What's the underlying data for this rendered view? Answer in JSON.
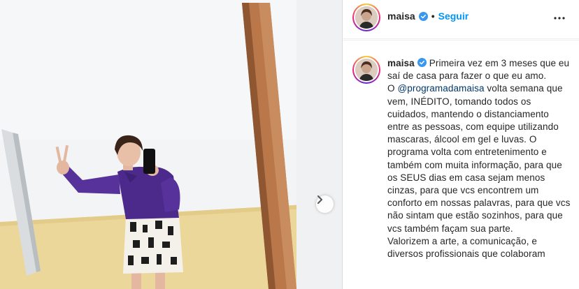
{
  "post": {
    "username": "maisa",
    "follow_label": "Seguir",
    "separator": "•",
    "caption": {
      "line1": "Primeira vez em 3 meses que eu saí de casa para fazer o que eu amo.",
      "p2_before": "O ",
      "mention": "@programadamaisa",
      "p2_after": " volta semana que vem, INÉDITO, tomando todos os cuidados, mantendo o distanciamento entre as pessoas, com equipe utilizando mascaras, álcool em gel e luvas. O programa volta com entretenimento e também com muita informação, para que os SEUS dias em casa sejam menos cinzas, para que vcs encontrem um conforto em nossas palavras, para que vcs não sintam que estão sozinhos, para que vcs também façam sua parte.",
      "p3": "Valorizem a arte, a comunicação, e diversos profissionais que colaboram"
    }
  },
  "icons": {
    "verified": "verified-badge-icon",
    "more": "more-options-icon",
    "next": "chevron-right-icon"
  },
  "colors": {
    "follow": "#0095f6",
    "verified": "#3897f0",
    "wall": "#f2f3f4",
    "yellow_band": "#ecd79a",
    "wood": "#b9774a",
    "blouse": "#4b2a8c"
  }
}
